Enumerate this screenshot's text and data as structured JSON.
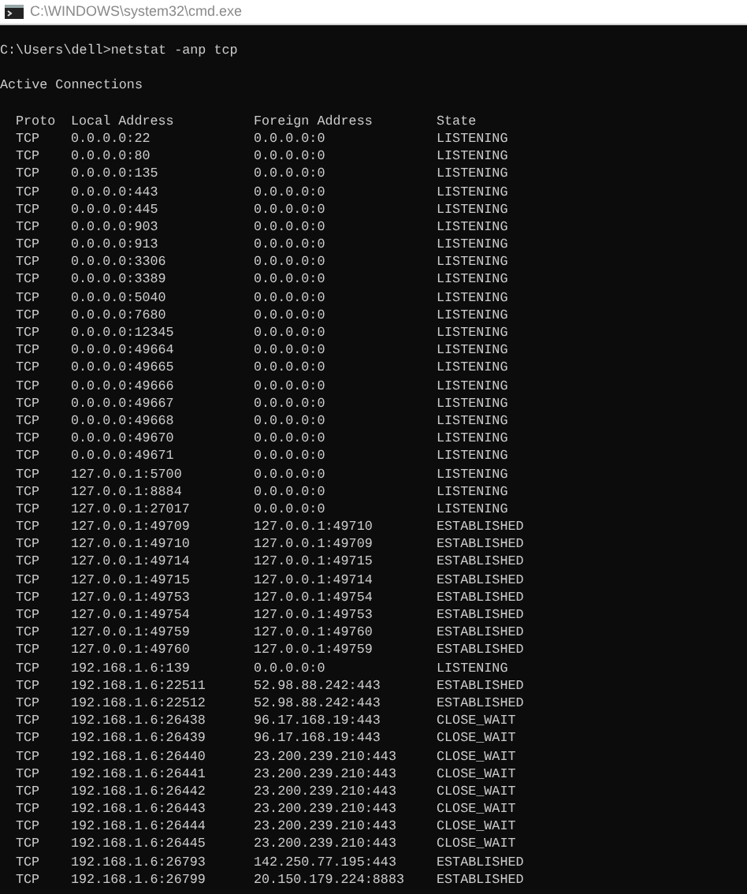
{
  "window": {
    "title": "C:\\WINDOWS\\system32\\cmd.exe"
  },
  "command": "C:\\Users\\dell>netstat -anp tcp",
  "heading": "Active Connections",
  "table": {
    "columns": [
      "Proto",
      "Local Address",
      "Foreign Address",
      "State"
    ],
    "rows": [
      [
        "TCP",
        "0.0.0.0:22",
        "0.0.0.0:0",
        "LISTENING"
      ],
      [
        "TCP",
        "0.0.0.0:80",
        "0.0.0.0:0",
        "LISTENING"
      ],
      [
        "TCP",
        "0.0.0.0:135",
        "0.0.0.0:0",
        "LISTENING"
      ],
      [
        "TCP",
        "0.0.0.0:443",
        "0.0.0.0:0",
        "LISTENING"
      ],
      [
        "TCP",
        "0.0.0.0:445",
        "0.0.0.0:0",
        "LISTENING"
      ],
      [
        "TCP",
        "0.0.0.0:903",
        "0.0.0.0:0",
        "LISTENING"
      ],
      [
        "TCP",
        "0.0.0.0:913",
        "0.0.0.0:0",
        "LISTENING"
      ],
      [
        "TCP",
        "0.0.0.0:3306",
        "0.0.0.0:0",
        "LISTENING"
      ],
      [
        "TCP",
        "0.0.0.0:3389",
        "0.0.0.0:0",
        "LISTENING"
      ],
      [
        "TCP",
        "0.0.0.0:5040",
        "0.0.0.0:0",
        "LISTENING"
      ],
      [
        "TCP",
        "0.0.0.0:7680",
        "0.0.0.0:0",
        "LISTENING"
      ],
      [
        "TCP",
        "0.0.0.0:12345",
        "0.0.0.0:0",
        "LISTENING"
      ],
      [
        "TCP",
        "0.0.0.0:49664",
        "0.0.0.0:0",
        "LISTENING"
      ],
      [
        "TCP",
        "0.0.0.0:49665",
        "0.0.0.0:0",
        "LISTENING"
      ],
      [
        "TCP",
        "0.0.0.0:49666",
        "0.0.0.0:0",
        "LISTENING"
      ],
      [
        "TCP",
        "0.0.0.0:49667",
        "0.0.0.0:0",
        "LISTENING"
      ],
      [
        "TCP",
        "0.0.0.0:49668",
        "0.0.0.0:0",
        "LISTENING"
      ],
      [
        "TCP",
        "0.0.0.0:49670",
        "0.0.0.0:0",
        "LISTENING"
      ],
      [
        "TCP",
        "0.0.0.0:49671",
        "0.0.0.0:0",
        "LISTENING"
      ],
      [
        "TCP",
        "127.0.0.1:5700",
        "0.0.0.0:0",
        "LISTENING"
      ],
      [
        "TCP",
        "127.0.0.1:8884",
        "0.0.0.0:0",
        "LISTENING"
      ],
      [
        "TCP",
        "127.0.0.1:27017",
        "0.0.0.0:0",
        "LISTENING"
      ],
      [
        "TCP",
        "127.0.0.1:49709",
        "127.0.0.1:49710",
        "ESTABLISHED"
      ],
      [
        "TCP",
        "127.0.0.1:49710",
        "127.0.0.1:49709",
        "ESTABLISHED"
      ],
      [
        "TCP",
        "127.0.0.1:49714",
        "127.0.0.1:49715",
        "ESTABLISHED"
      ],
      [
        "TCP",
        "127.0.0.1:49715",
        "127.0.0.1:49714",
        "ESTABLISHED"
      ],
      [
        "TCP",
        "127.0.0.1:49753",
        "127.0.0.1:49754",
        "ESTABLISHED"
      ],
      [
        "TCP",
        "127.0.0.1:49754",
        "127.0.0.1:49753",
        "ESTABLISHED"
      ],
      [
        "TCP",
        "127.0.0.1:49759",
        "127.0.0.1:49760",
        "ESTABLISHED"
      ],
      [
        "TCP",
        "127.0.0.1:49760",
        "127.0.0.1:49759",
        "ESTABLISHED"
      ],
      [
        "TCP",
        "192.168.1.6:139",
        "0.0.0.0:0",
        "LISTENING"
      ],
      [
        "TCP",
        "192.168.1.6:22511",
        "52.98.88.242:443",
        "ESTABLISHED"
      ],
      [
        "TCP",
        "192.168.1.6:22512",
        "52.98.88.242:443",
        "ESTABLISHED"
      ],
      [
        "TCP",
        "192.168.1.6:26438",
        "96.17.168.19:443",
        "CLOSE_WAIT"
      ],
      [
        "TCP",
        "192.168.1.6:26439",
        "96.17.168.19:443",
        "CLOSE_WAIT"
      ],
      [
        "TCP",
        "192.168.1.6:26440",
        "23.200.239.210:443",
        "CLOSE_WAIT"
      ],
      [
        "TCP",
        "192.168.1.6:26441",
        "23.200.239.210:443",
        "CLOSE_WAIT"
      ],
      [
        "TCP",
        "192.168.1.6:26442",
        "23.200.239.210:443",
        "CLOSE_WAIT"
      ],
      [
        "TCP",
        "192.168.1.6:26443",
        "23.200.239.210:443",
        "CLOSE_WAIT"
      ],
      [
        "TCP",
        "192.168.1.6:26444",
        "23.200.239.210:443",
        "CLOSE_WAIT"
      ],
      [
        "TCP",
        "192.168.1.6:26445",
        "23.200.239.210:443",
        "CLOSE_WAIT"
      ],
      [
        "TCP",
        "192.168.1.6:26793",
        "142.250.77.195:443",
        "ESTABLISHED"
      ],
      [
        "TCP",
        "192.168.1.6:26799",
        "20.150.179.224:8883",
        "ESTABLISHED"
      ]
    ]
  }
}
